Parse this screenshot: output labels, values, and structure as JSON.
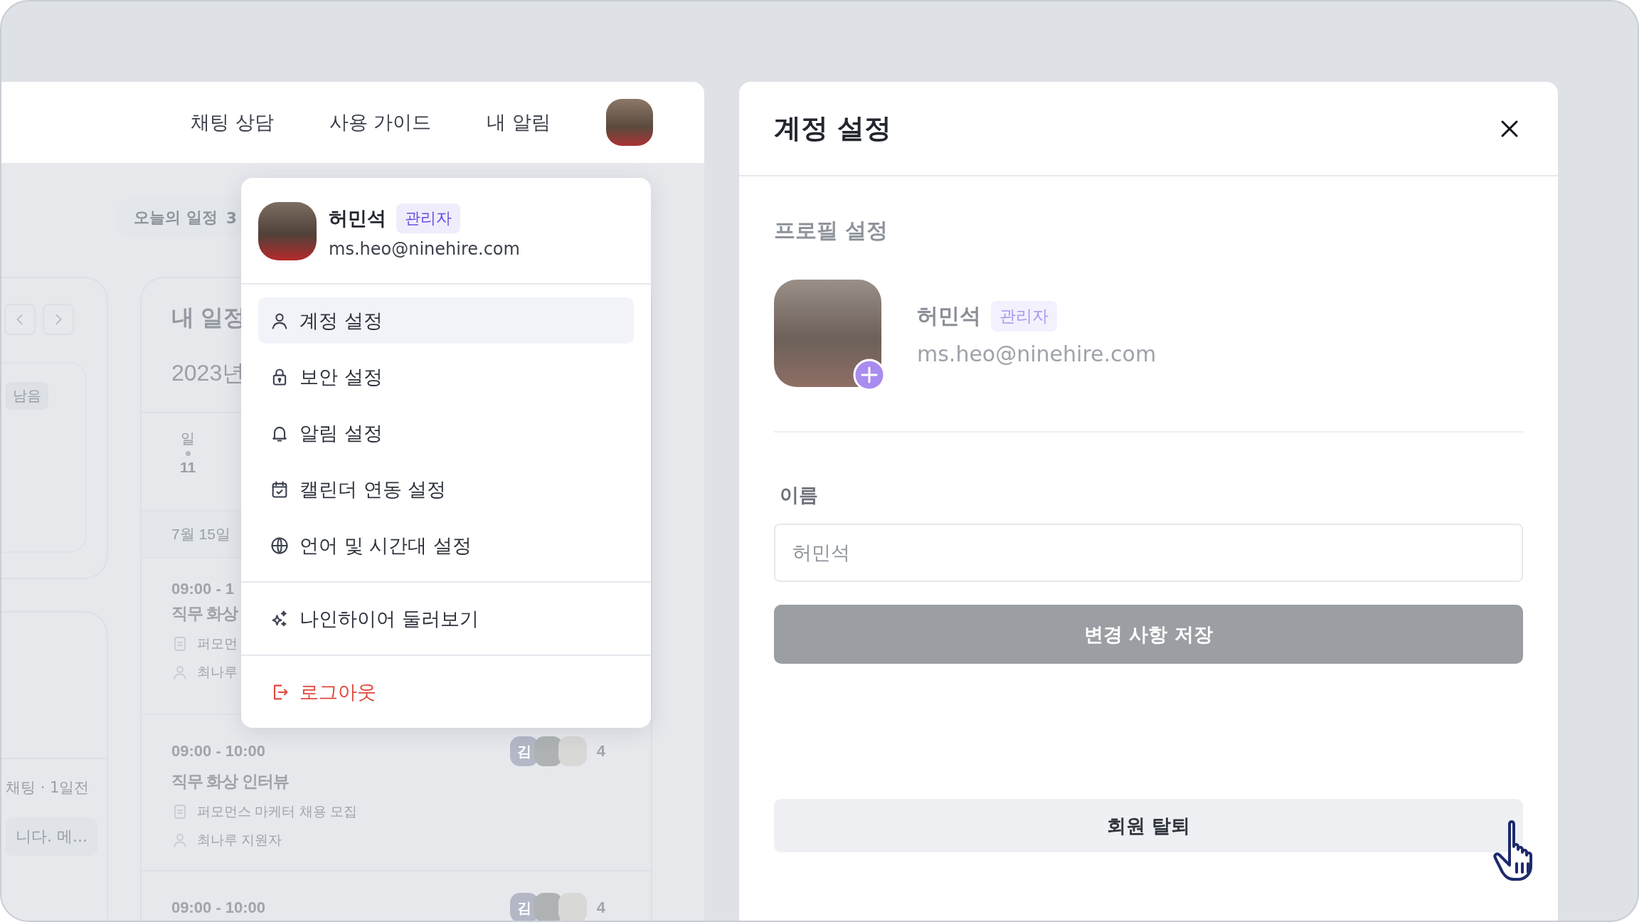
{
  "nav": {
    "links": [
      {
        "label": "채팅 상담"
      },
      {
        "label": "사용 가이드"
      },
      {
        "label": "내 알림"
      }
    ]
  },
  "today": {
    "label": "오늘의 일정",
    "count": "3"
  },
  "calendar_card": {
    "tag": "남음"
  },
  "chat_card": {
    "meta": "채팅 · 1일전",
    "preview": "니다. 메..."
  },
  "schedule": {
    "title": "내 일정",
    "year": "2023년",
    "day": {
      "weekday": "일",
      "date": "11"
    },
    "date_header": "7월 15일",
    "events": [
      {
        "time": "09:00 - 1",
        "title": "직무 화상",
        "posting": "퍼모먼",
        "applicant": "최나루"
      },
      {
        "time": "09:00 - 10:00",
        "title": "직무 화상 인터뷰",
        "posting": "퍼모먼스 마케터 채용 모집",
        "applicant": "최나루 지원자",
        "initial": "김",
        "count": "4"
      },
      {
        "time": "09:00 - 10:00",
        "initial": "김",
        "count": "4"
      }
    ]
  },
  "dropdown": {
    "user": {
      "name": "허민석",
      "role": "관리자",
      "email": "ms.heo@ninehire.com"
    },
    "sections": [
      {
        "items": [
          {
            "label": "계정 설정",
            "selected": true,
            "kind": "normal"
          },
          {
            "label": "보안 설정",
            "selected": false,
            "kind": "normal"
          },
          {
            "label": "알림 설정",
            "selected": false,
            "kind": "normal"
          },
          {
            "label": "캘린더 연동 설정",
            "selected": false,
            "kind": "normal"
          },
          {
            "label": "언어 및 시간대 설정",
            "selected": false,
            "kind": "normal"
          }
        ]
      },
      {
        "items": [
          {
            "label": "나인하이어 둘러보기",
            "selected": false,
            "kind": "normal"
          }
        ]
      },
      {
        "items": [
          {
            "label": "로그아웃",
            "selected": false,
            "kind": "danger"
          }
        ]
      }
    ]
  },
  "modal": {
    "title": "계정 설정",
    "section": "프로필 설정",
    "user": {
      "name": "허민석",
      "role": "관리자",
      "email": "ms.heo@ninehire.com"
    },
    "name_field": {
      "label": "이름",
      "value": "허민석"
    },
    "save_button": {
      "label": "변경 사항 저장",
      "disabled": true
    },
    "withdraw_button": {
      "label": "회원 탈퇴"
    }
  }
}
